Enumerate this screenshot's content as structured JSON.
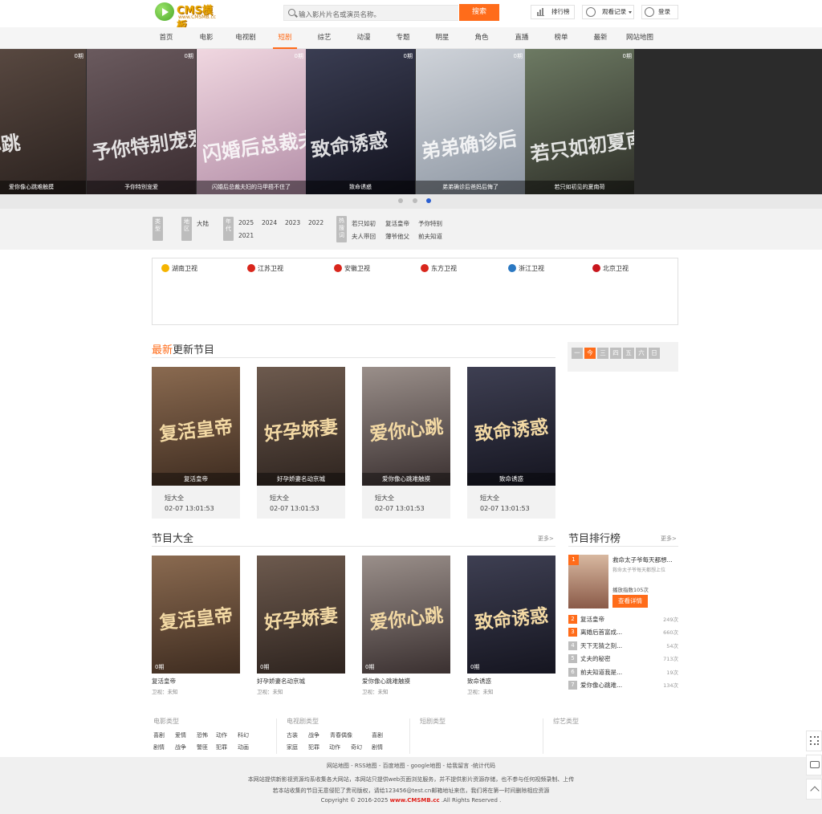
{
  "header": {
    "logo_text": "CMS模板",
    "logo_sub": "www.CMSMB.cc",
    "search_placeholder": "输入影片片名或演员名称。",
    "search_button": "搜索",
    "rank_label": "排行榜",
    "history_label": "观看记录",
    "login_label": "登录"
  },
  "nav": [
    "首页",
    "电影",
    "电视剧",
    "短剧",
    "综艺",
    "动漫",
    "专题",
    "明星",
    "角色",
    "直播",
    "榜单",
    "最新",
    "网站地图"
  ],
  "nav_active": "短剧",
  "banner": [
    {
      "ep": "0期",
      "caption": "爱你像心跳难触摸",
      "color1": "#5a4a42",
      "color2": "#2a211e",
      "big": "心跳"
    },
    {
      "ep": "0期",
      "caption": "予你特别宠爱",
      "color1": "#6a5a5e",
      "color2": "#3a2c30",
      "big": "予你特别宠爱"
    },
    {
      "ep": "0期",
      "caption": "闪婚后总裁夫妇的马甲捂不住了",
      "color1": "#f0d7e0",
      "color2": "#b48fa8",
      "big": "闪婚后总裁夫妇"
    },
    {
      "ep": "0期",
      "caption": "致命诱惑",
      "color1": "#3a3d52",
      "color2": "#12121e",
      "big": "致命诱惑"
    },
    {
      "ep": "0期",
      "caption": "弟弟确诊后爸妈后悔了",
      "color1": "#cfd3d9",
      "color2": "#8e97a3",
      "big": "弟弟确诊后"
    },
    {
      "ep": "0期",
      "caption": "若只如初见的夏南荷",
      "color1": "#6d7a63",
      "color2": "#2e2f28",
      "big": "若只如初夏南荷"
    }
  ],
  "filters": {
    "type_label": "类型",
    "region_label": "地区",
    "region_value": "大陆",
    "year_label": "年代",
    "years": [
      "2025",
      "2024",
      "2023",
      "2022",
      "2021"
    ],
    "hot_label": "热搜词",
    "hot_words": [
      "若只如初",
      "复活皇帝",
      "予你特别",
      "夫人带回",
      "薄爷他父",
      "前夫知道"
    ]
  },
  "channels": [
    {
      "name": "湖南卫视",
      "color": "#f5b400"
    },
    {
      "name": "江苏卫视",
      "color": "#d9261c"
    },
    {
      "name": "安徽卫视",
      "color": "#d9261c"
    },
    {
      "name": "东方卫视",
      "color": "#d9261c"
    },
    {
      "name": "浙江卫视",
      "color": "#2b78c2"
    },
    {
      "name": "北京卫视",
      "color": "#c8161d"
    }
  ],
  "latest": {
    "title_hl": "最新",
    "title_rest": "更新节目",
    "items": [
      {
        "title": "复活皇帝",
        "cat": "短大全",
        "time": "02-07 13:01:53",
        "big": "复活皇帝",
        "c1": "#8a6a50",
        "c2": "#3e2c20"
      },
      {
        "title": "好孕娇妻名动京城",
        "cat": "短大全",
        "time": "02-07 13:01:53",
        "big": "好孕娇妻",
        "c1": "#6d5a4e",
        "c2": "#2e241f"
      },
      {
        "title": "爱你像心跳难触摸",
        "cat": "短大全",
        "time": "02-07 13:01:53",
        "big": "爱你心跳",
        "c1": "#9a8f8a",
        "c2": "#3a3030"
      },
      {
        "title": "致命诱惑",
        "cat": "短大全",
        "time": "02-07 13:01:53",
        "big": "致命诱惑",
        "c1": "#3e3f52",
        "c2": "#151520"
      }
    ]
  },
  "calendar": [
    "一",
    "今",
    "三",
    "四",
    "五",
    "六",
    "日"
  ],
  "all": {
    "title": "节目大全",
    "more": "更多>",
    "items": [
      {
        "title": "复活皇帝",
        "ep": "0期",
        "sub": "卫视：未知",
        "big": "复活皇帝",
        "c1": "#8a6a50",
        "c2": "#3e2c20"
      },
      {
        "title": "好孕娇妻名动京城",
        "ep": "0期",
        "sub": "卫视：未知",
        "big": "好孕娇妻",
        "c1": "#6d5a4e",
        "c2": "#2e241f"
      },
      {
        "title": "爱你像心跳难触摸",
        "ep": "0期",
        "sub": "卫视：未知",
        "big": "爱你心跳",
        "c1": "#9a8f8a",
        "c2": "#3a3030"
      },
      {
        "title": "致命诱惑",
        "ep": "0期",
        "sub": "卫视：未知",
        "big": "致命诱惑",
        "c1": "#3e3f52",
        "c2": "#151520"
      }
    ]
  },
  "ranking": {
    "title": "节目排行榜",
    "more": "更多>",
    "top": {
      "num": "1",
      "title": "救命太子爷每天都想...",
      "sub": "救命太子爷每天都想上位",
      "plays": "播放指数105次",
      "button": "查看详情"
    },
    "items": [
      {
        "num": "2",
        "name": "复活皇帝",
        "count": "249次",
        "color": "#ff6c1a"
      },
      {
        "num": "3",
        "name": "离婚后首富成...",
        "count": "660次",
        "color": "#ff6c1a"
      },
      {
        "num": "4",
        "name": "天下无猜之刻...",
        "count": "54次",
        "color": "#bdbdbd"
      },
      {
        "num": "5",
        "name": "丈夫的秘密",
        "count": "713次",
        "color": "#bdbdbd"
      },
      {
        "num": "6",
        "name": "前夫知道我是...",
        "count": "19次",
        "color": "#bdbdbd"
      },
      {
        "num": "7",
        "name": "爱你像心跳难...",
        "count": "134次",
        "color": "#bdbdbd"
      }
    ]
  },
  "foot_cats": {
    "movie": {
      "title": "电影类型",
      "row1": [
        "喜剧",
        "爱情",
        "恐怖",
        "动作",
        "科幻"
      ],
      "row2": [
        "剧情",
        "战争",
        "警匪",
        "犯罪",
        "动画"
      ]
    },
    "tv": {
      "title": "电视剧类型",
      "row1": [
        "古装",
        "战争",
        "青春偶像",
        "喜剧"
      ],
      "row2": [
        "家庭",
        "犯罪",
        "动作",
        "奇幻",
        "剧情"
      ]
    },
    "short": {
      "title": "短剧类型"
    },
    "variety": {
      "title": "综艺类型"
    }
  },
  "footer": {
    "links": "网站地图  -  RSS地图  -  百度地图  -  google地图  -  给我留言  -统计代码",
    "line1": "本网站提供新影视资源均系收集各大网站，本网站只提供web页面浏览服务，并不提供影片资源存储，也不参与任何视频录制、上传",
    "line2": "若本站收集的节目无意侵犯了贵司版权，请给123456@test.cn邮箱地址来信，我们将在第一时间删除相应资源",
    "copyright_pre": "Copyright © 2016-2025 ",
    "copyright_site": "www.CMSMB.cc",
    "copyright_post": " .All Rights Reserved ."
  }
}
